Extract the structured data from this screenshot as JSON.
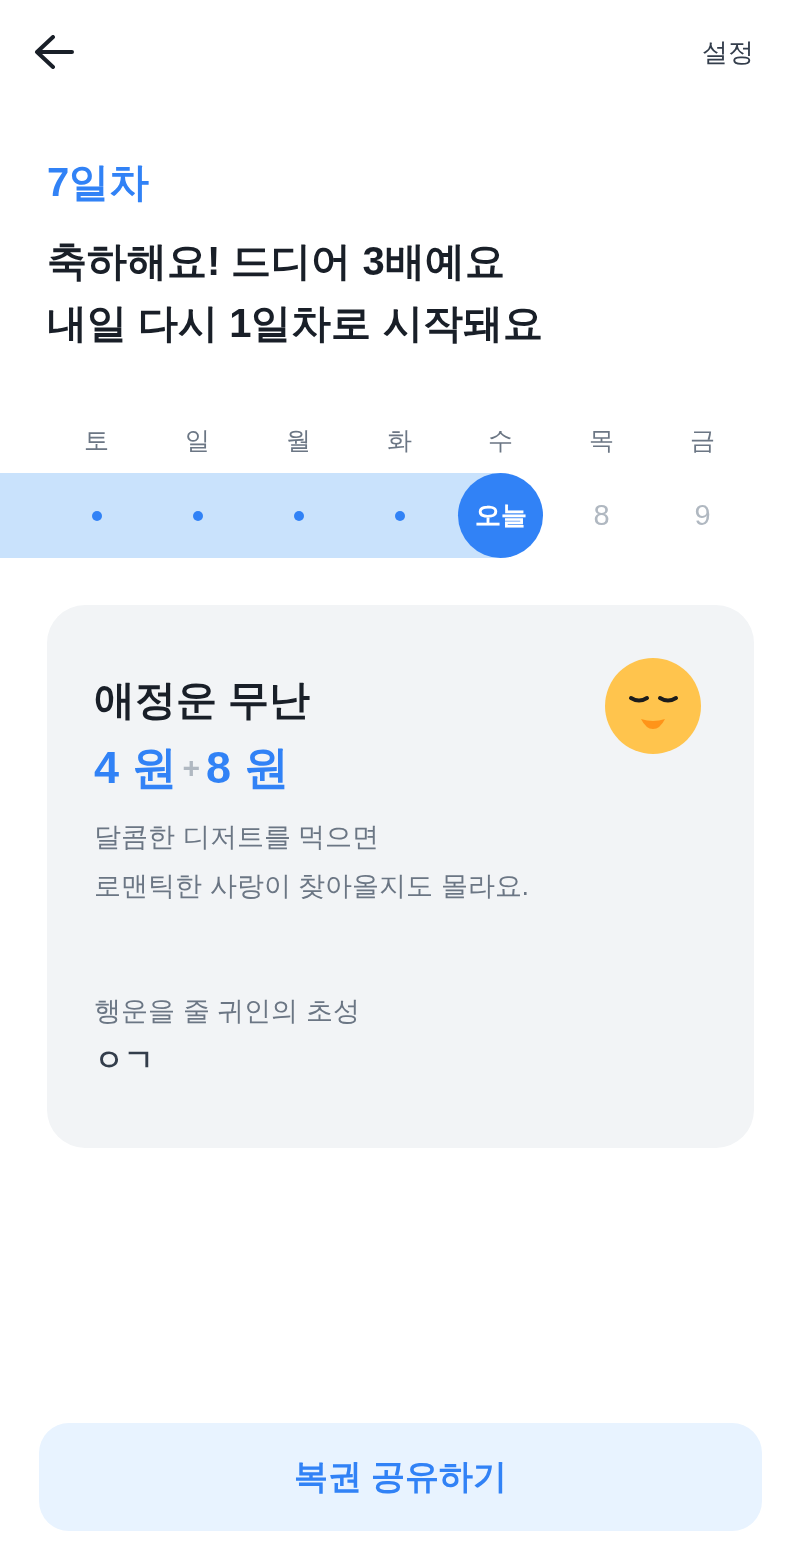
{
  "top_bar": {
    "settings_label": "설정"
  },
  "streak": {
    "day_label": "7일차",
    "headline": "축하해요! 드디어 3배예요\n내일 다시 1일차로 시작돼요"
  },
  "week": [
    {
      "day": "토",
      "kind": "done"
    },
    {
      "day": "일",
      "kind": "done"
    },
    {
      "day": "월",
      "kind": "done"
    },
    {
      "day": "화",
      "kind": "done"
    },
    {
      "day": "수",
      "kind": "today",
      "mark": "오늘"
    },
    {
      "day": "목",
      "kind": "upcoming",
      "mark": "8"
    },
    {
      "day": "금",
      "kind": "upcoming",
      "mark": "9"
    }
  ],
  "fortune_card": {
    "title": "애정운 무난",
    "base_amount": "4 원",
    "plus": "+",
    "bonus_amount": "8 원",
    "description": "달콤한 디저트를 먹으면\n로맨틱한 사랑이 찾아올지도 몰라요.",
    "hint_label": "행운을 줄 귀인의 초성",
    "initials": "ㅇㄱ"
  },
  "share_button": {
    "label": "복권 공유하기"
  }
}
